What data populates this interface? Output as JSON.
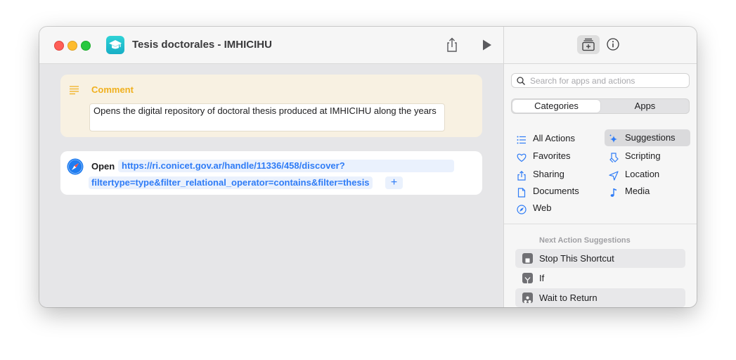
{
  "window": {
    "title": "Tesis doctorales - IMHICIHU",
    "app_icon": "graduation-cap-icon",
    "accent_color": "#22c1cd"
  },
  "comment": {
    "label": "Comment",
    "text": "Opens the digital repository of doctoral thesis produced at IMHICIHU along the years",
    "label_color": "#f0b01e"
  },
  "open_action": {
    "label": "Open",
    "url_line1": "https://ri.conicet.gov.ar/handle/11336/458/discover?",
    "url_line2": "filtertype=type&filter_relational_operator=contains&filter=thesis",
    "add_symbol": "+",
    "link_color": "#2f7cf6"
  },
  "sidebar": {
    "search_placeholder": "Search for apps and actions",
    "segments": [
      "Categories",
      "Apps"
    ],
    "selected_segment": "Categories",
    "categories": [
      {
        "label": "All Actions",
        "icon": "list-icon"
      },
      {
        "label": "Suggestions",
        "icon": "sparkle-icon",
        "selected": true
      },
      {
        "label": "Favorites",
        "icon": "heart-icon"
      },
      {
        "label": "Scripting",
        "icon": "scripting-icon"
      },
      {
        "label": "Sharing",
        "icon": "share-icon"
      },
      {
        "label": "Location",
        "icon": "location-arrow-icon"
      },
      {
        "label": "Documents",
        "icon": "document-icon"
      },
      {
        "label": "Media",
        "icon": "music-note-icon"
      },
      {
        "label": "Web",
        "icon": "compass-icon"
      }
    ],
    "next_header": "Next Action Suggestions",
    "suggestions": [
      {
        "label": "Stop This Shortcut",
        "icon": "stop-icon"
      },
      {
        "label": "If",
        "icon": "if-branch-icon"
      },
      {
        "label": "Wait to Return",
        "icon": "wait-icon"
      }
    ]
  }
}
